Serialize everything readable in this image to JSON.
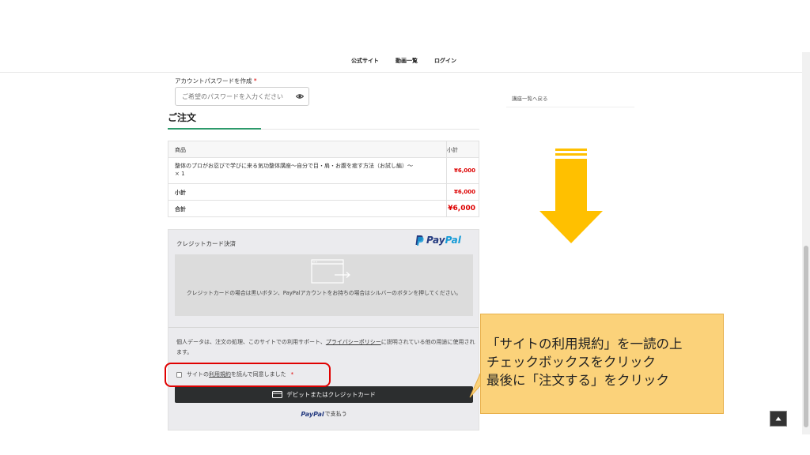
{
  "nav": {
    "items": [
      {
        "label": "公式サイト"
      },
      {
        "label": "動画一覧"
      },
      {
        "label": "ログイン"
      }
    ]
  },
  "account": {
    "password_label": "アカウントパスワードを作成",
    "required_mark": "*",
    "password_placeholder": "ご希望のパスワードを入力ください"
  },
  "sidebar": {
    "back_link": "講座一覧へ戻る"
  },
  "order": {
    "title": "ご注文",
    "table": {
      "header_product": "商品",
      "header_subtotal": "小計",
      "item_name": "整体のプロがお忍びで学びに来る気功整体講座〜自分で目・肩・お腹を癒す方法（お試し編）〜",
      "item_qty": "× 1",
      "item_price": "¥6,000",
      "subtotal_label": "小計",
      "subtotal_value": "¥6,000",
      "total_label": "合計",
      "total_value": "¥6,000"
    }
  },
  "payment": {
    "method_title": "クレジットカード決済",
    "paypal_logo_pay": "Pay",
    "paypal_logo_pal": "Pal",
    "card_notice": "クレジットカードの場合は黒いボタン、PayPalアカウントをお持ちの場合はシルバーのボタンを押してください。",
    "privacy_text_1": "個人データは、注文の処理、このサイトでの利用サポート、",
    "privacy_link": "プライバシーポリシー",
    "privacy_text_2": "に説明されている他の用途に使用されます。",
    "terms_text_1": "サイトの",
    "terms_link": "利用規約",
    "terms_text_2": "を読んで同意しました",
    "terms_required": "*",
    "debit_button": "デビットまたはクレジットカード",
    "paypal_button_logo": "PayPal",
    "paypal_button_suffix": "で支払う"
  },
  "callout": {
    "lines": [
      "「サイトの利用規約」を一読の上",
      "チェックボックスをクリック",
      "最後に「注文する」をクリック"
    ]
  },
  "colors": {
    "accent_green": "#2d9a6b",
    "price_red": "#dd0000",
    "highlight_red": "#e00000",
    "arrow_yellow": "#ffc000",
    "callout_fill": "#fbd27a",
    "paypal_dark": "#253b80",
    "paypal_light": "#179bd7"
  },
  "icons": {
    "password_toggle": "eye-icon",
    "card_placeholder": "card-window-icon",
    "debit_button": "credit-card-icon",
    "back_to_top": "chevron-up-icon",
    "guide_arrow": "down-arrow"
  }
}
